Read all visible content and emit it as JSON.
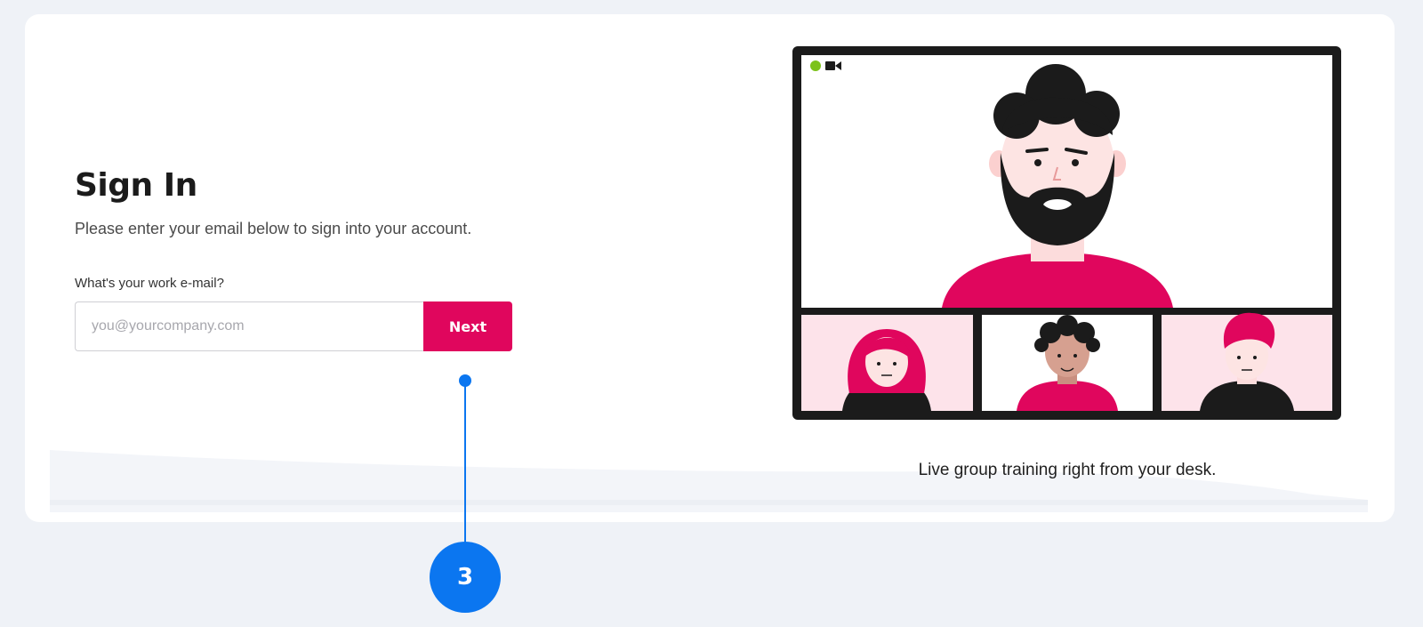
{
  "signin": {
    "title": "Sign In",
    "subtitle": "Please enter your email below to sign into your account.",
    "email_label": "What's your work e-mail?",
    "email_placeholder": "you@yourcompany.com",
    "email_value": "",
    "next_label": "Next"
  },
  "illustration": {
    "caption": "Live group training right from your desk.",
    "live_indicator_icon": "green-dot-icon",
    "camera_icon": "video-camera-icon"
  },
  "callout": {
    "number": "3"
  },
  "colors": {
    "brand": "#e0065d",
    "callout": "#0b76f0",
    "live": "#7cc21b",
    "background": "#eff2f7"
  }
}
